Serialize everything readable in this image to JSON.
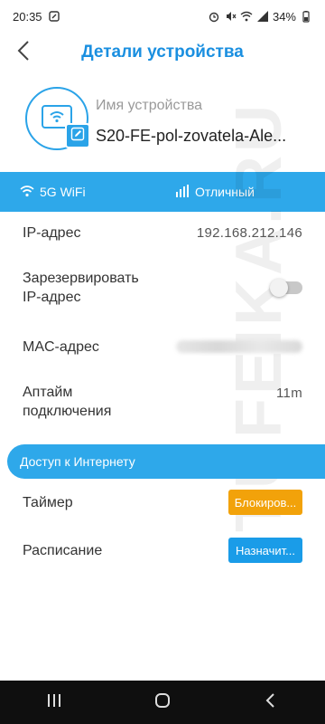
{
  "status_bar": {
    "time": "20:35",
    "battery": "34%",
    "icons": [
      "notification-icon",
      "alarm-icon",
      "mute-icon",
      "wifi-icon",
      "signal-icon",
      "battery-icon"
    ]
  },
  "header": {
    "title": "Детали устройства",
    "back_icon": "chevron-left-icon"
  },
  "device": {
    "name_label": "Имя устройства",
    "name": "S20-FE-pol-zovatela-Ale...",
    "icon": "tablet-wifi-icon",
    "edit_icon": "edit-icon"
  },
  "signal": {
    "band": "5G WiFi",
    "quality": "Отличный",
    "accent": "#2ea8ea"
  },
  "details": {
    "ip_label": "IP-адрес",
    "ip_value": "192.168.212.146",
    "reserve_label_line1": "Зарезервировать",
    "reserve_label_line2": "IP-адрес",
    "reserve_enabled": false,
    "mac_label": "MAC-адрес",
    "uptime_label_line1": "Аптайм",
    "uptime_label_line2": "подключения",
    "uptime_value": "11m"
  },
  "internet_access": {
    "title": "Доступ к Интернету",
    "timer_label": "Таймер",
    "timer_button": "Блокиров...",
    "schedule_label": "Расписание",
    "schedule_button": "Назначит...",
    "colors": {
      "orange": "#f2a20a",
      "blue": "#1a9ce8"
    }
  },
  "watermark": "TUFEIKA.RU",
  "nav_bar": {
    "icons": [
      "recent-apps-icon",
      "home-icon",
      "back-icon"
    ]
  }
}
